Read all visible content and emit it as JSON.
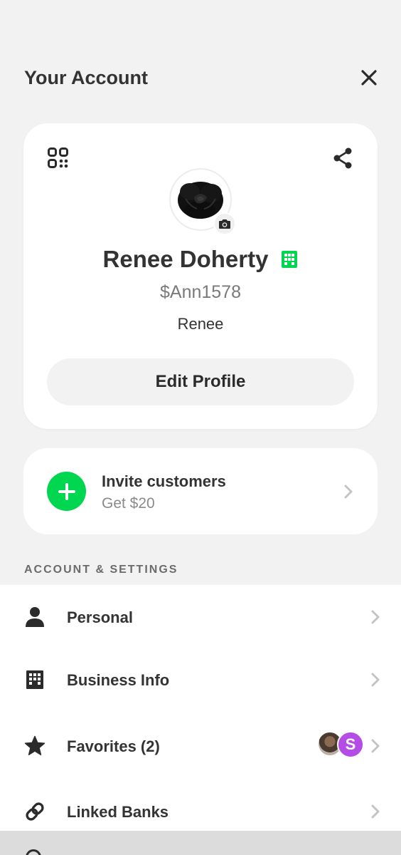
{
  "header": {
    "title": "Your Account"
  },
  "profile": {
    "name": "Renee Doherty",
    "cashtag": "$Ann1578",
    "display_name": "Renee",
    "edit_label": "Edit Profile",
    "business_badge_color": "#00d64f"
  },
  "invite": {
    "title": "Invite customers",
    "subtitle": "Get $20",
    "accent": "#00d64f"
  },
  "settings": {
    "section_label": "ACCOUNT & SETTINGS",
    "items": [
      {
        "label": "Personal",
        "icon": "person-icon"
      },
      {
        "label": "Business Info",
        "icon": "building-icon"
      },
      {
        "label": "Favorites (2)",
        "icon": "star-icon",
        "avatar_letter": "S"
      },
      {
        "label": "Linked Banks",
        "icon": "link-icon"
      }
    ]
  }
}
